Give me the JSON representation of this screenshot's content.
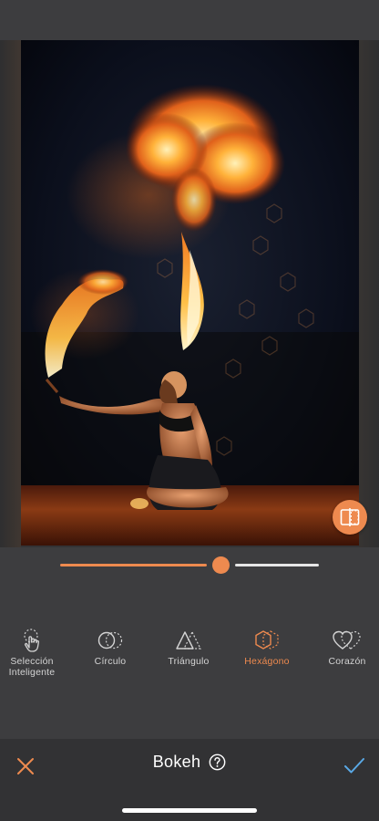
{
  "editor": {
    "title": "Bokeh",
    "effect_strength": 0.62
  },
  "tools": [
    {
      "id": "smart",
      "label": "Selección\nInteligente",
      "icon": "hand-tap-icon",
      "active": false
    },
    {
      "id": "circle",
      "label": "Círculo",
      "icon": "circle-bokeh-icon",
      "active": false
    },
    {
      "id": "triangle",
      "label": "Triángulo",
      "icon": "triangle-bokeh-icon",
      "active": false
    },
    {
      "id": "hexagon",
      "label": "Hexágono",
      "icon": "hexagon-bokeh-icon",
      "active": true
    },
    {
      "id": "heart",
      "label": "Corazón",
      "icon": "heart-bokeh-icon",
      "active": false
    }
  ],
  "colors": {
    "accent": "#ee8a4f",
    "confirm": "#5aa9e6",
    "toolbar_bg": "#3d3d3f",
    "bottom_bg": "#323234"
  },
  "icons": {
    "cancel": "close-icon",
    "confirm": "checkmark-icon",
    "help": "question-circle-icon",
    "compare": "split-compare-icon"
  }
}
